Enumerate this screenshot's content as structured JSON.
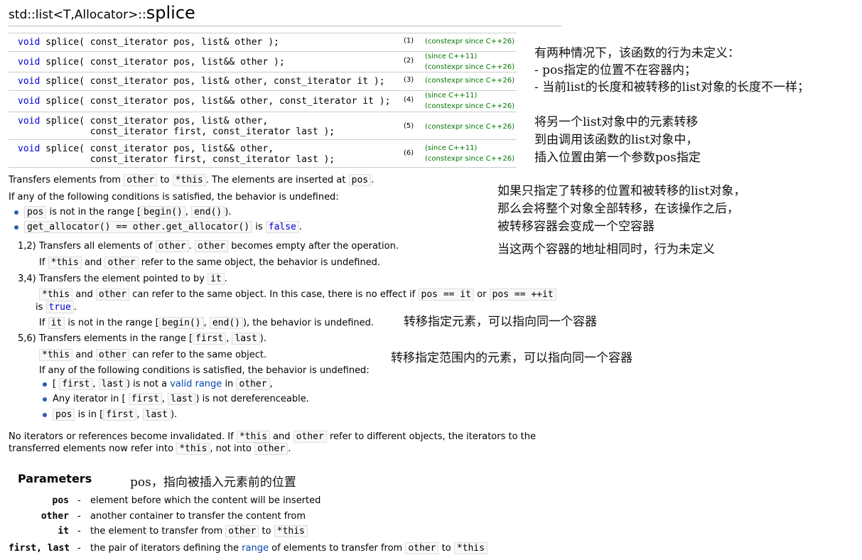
{
  "heading": {
    "scope": "std::list<T,Allocator>::",
    "name": "splice"
  },
  "overloads": [
    {
      "sig": [
        "void splice( const_iterator pos, list& other );"
      ],
      "num": "(1)",
      "ver": [
        "(constexpr since C++26)"
      ]
    },
    {
      "sig": [
        "void splice( const_iterator pos, list&& other );"
      ],
      "num": "(2)",
      "ver": [
        "(since C++11)",
        "(constexpr since C++26)"
      ]
    },
    {
      "sig": [
        "void splice( const_iterator pos, list& other, const_iterator it );"
      ],
      "num": "(3)",
      "ver": [
        "(constexpr since C++26)"
      ]
    },
    {
      "sig": [
        "void splice( const_iterator pos, list&& other, const_iterator it );"
      ],
      "num": "(4)",
      "ver": [
        "(since C++11)",
        "(constexpr since C++26)"
      ]
    },
    {
      "sig": [
        "void splice( const_iterator pos, list& other,",
        "             const_iterator first, const_iterator last );"
      ],
      "num": "(5)",
      "ver": [
        "(constexpr since C++26)"
      ]
    },
    {
      "sig": [
        "void splice( const_iterator pos, list&& other,",
        "             const_iterator first, const_iterator last );"
      ],
      "num": "(6)",
      "ver": [
        "(since C++11)",
        "(constexpr since C++26)"
      ]
    }
  ],
  "intro": {
    "a": "Transfers elements from",
    "b": "other",
    "c": "to",
    "d": "*this",
    "e": ". The elements are inserted at",
    "f": "pos",
    "g": "."
  },
  "cond_head": "If any of the following conditions is satisfied, the behavior is undefined:",
  "cond1": {
    "a": "pos",
    "b": "is not in the range [",
    "c": "begin()",
    "d": ",",
    "e": "end()",
    "f": ")."
  },
  "cond2": {
    "a": "get_allocator() == other.get_allocator()",
    "b": "is",
    "c": "false",
    "d": "."
  },
  "s12": {
    "label": "1,2)",
    "a": "Transfers all elements of",
    "b": "other",
    "c": ".",
    "d": "other",
    "e": "becomes empty after the operation.",
    "l2a": "If",
    "l2b": "*this",
    "l2c": "and",
    "l2d": "other",
    "l2e": "refer to the same object, the behavior is undefined."
  },
  "s34": {
    "label": "3,4)",
    "a": "Transfers the element pointed to by",
    "b": "it",
    "c": ".",
    "l2a": "*this",
    "l2b": "and",
    "l2c": "other",
    "l2d": "can refer to the same object. In this case, there is no effect if",
    "l2e": "pos == it",
    "l2f": "or",
    "l2g": "pos == ++it",
    "l3a": "is",
    "l3b": "true",
    "l3c": ".",
    "l4a": "If",
    "l4b": "it",
    "l4c": "is not in the range [",
    "l4d": "begin()",
    "l4e": ",",
    "l4f": "end()",
    "l4g": "), the behavior is undefined."
  },
  "s56": {
    "label": "5,6)",
    "a": "Transfers elements in the range [",
    "b": "first",
    "c": ",",
    "d": "last",
    "e": ").",
    "l2a": "*this",
    "l2b": "and",
    "l2c": "other",
    "l2d": "can refer to the same object.",
    "l3": "If any of the following conditions is satisfied, the behavior is undefined:",
    "b1a": "[",
    "b1b": "first",
    "b1c": ",",
    "b1d": "last",
    "b1e": ") is not a",
    "b1f": "valid range",
    "b1g": "in",
    "b1h": "other",
    "b1i": ",",
    "b2a": "Any iterator in [",
    "b2b": "first",
    "b2c": ",",
    "b2d": "last",
    "b2e": ") is not dereferenceable.",
    "b3a": "pos",
    "b3b": "is in [",
    "b3c": "first",
    "b3d": ",",
    "b3e": "last",
    "b3f": ")."
  },
  "footer": {
    "a": "No iterators or references become invalidated. If",
    "b": "*this",
    "c": "and",
    "d": "other",
    "e": "refer to different objects, the iterators to the",
    "f": "transferred elements now refer into",
    "g": "*this",
    "h": ", not into",
    "i": "other",
    "j": "."
  },
  "params": {
    "title": "Parameters",
    "rows": [
      {
        "name": "pos",
        "dash": "-",
        "desc": "element before which the content will be inserted"
      },
      {
        "name": "other",
        "dash": "-",
        "desc": "another container to transfer the content from"
      },
      {
        "name": "it",
        "dash": "-",
        "desc": "the element to transfer from",
        "c1": "other",
        "t2": "to",
        "c2": "*this"
      },
      {
        "name": "first, last",
        "dash": "-",
        "desc": "the pair of iterators defining the",
        "link": "range",
        "t2": "of elements to transfer from",
        "c1": "other",
        "t3": "to",
        "c2": "*this"
      }
    ]
  },
  "notes": {
    "n1": [
      "有两种情况下，该函数的行为未定义：",
      "- pos指定的位置不在容器内；",
      "- 当前list的长度和被转移的list对象的长度不一样；"
    ],
    "n2": [
      "将另一个list对象中的元素转移",
      "到由调用该函数的list对象中，",
      "插入位置由第一个参数pos指定"
    ],
    "n3": [
      "如果只指定了转移的位置和被转移的list对象，",
      "那么会将整个对象全部转移，在该操作之后，",
      "被转移容器会变成一个空容器"
    ],
    "n4": "当这两个容器的地址相同时，行为未定义",
    "n5": "转移指定元素，可以指向同一个容器",
    "n6": "转移指定范围内的元素，可以指向同一个容器",
    "n7": "pos，指向被插入元素前的位置"
  },
  "colors": {
    "keyword": "#0000dd",
    "link": "#0645ad",
    "version": "#007700",
    "bullet": "#2a5db0"
  }
}
